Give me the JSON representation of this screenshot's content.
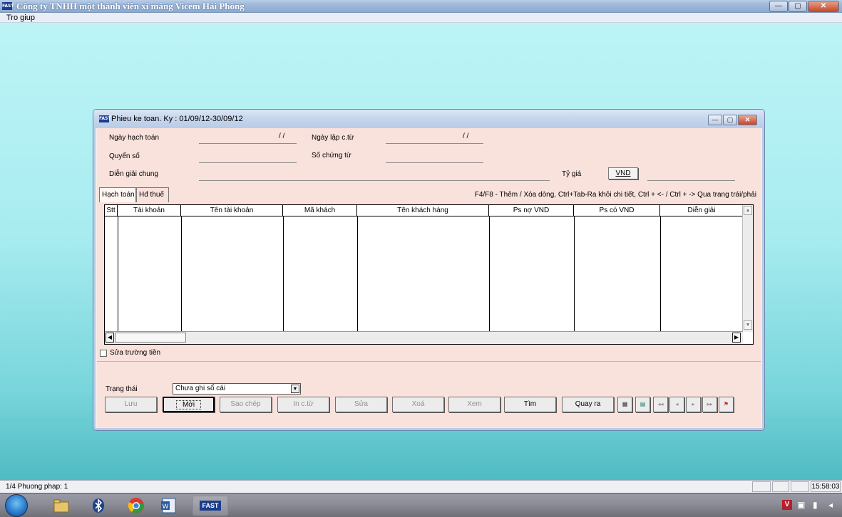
{
  "app": {
    "title": "Công ty TNHH một thành viên xi măng Vicem Hải Phòng",
    "logo_text": "FAST",
    "window_buttons": [
      "—",
      "▢",
      "✕"
    ]
  },
  "menu": {
    "items": [
      "Tro giup"
    ]
  },
  "form": {
    "title": "Phieu ke toan. Ky : 01/09/12-30/09/12",
    "window_buttons": [
      "—",
      "▢",
      "✕"
    ],
    "ngay_hach_toan_label": "Ngày hạch toán",
    "ngay_hach_toan_value": "/ /",
    "ngay_lap_label": "Ngày lập c.từ",
    "ngay_lap_value": "/ /",
    "quyen_so_label": "Quyển số",
    "so_chung_tu_label": "Số chứng từ",
    "dien_giai_label": "Diễn giải chung",
    "ty_gia_label": "Tỷ giá",
    "currency_button": "VND",
    "tabs": [
      "Hạch toán",
      "Hđ thuế"
    ],
    "hint": "F4/F8 - Thêm / Xóa dòng, Ctrl+Tab-Ra khỏi chi tiết, Ctrl + <- / Ctrl + -> Qua trang trái/phải",
    "columns": [
      "Stt",
      "Tài khoản",
      "Tên tài khoản",
      "Mã khách",
      "Tên khách hàng",
      "Ps nợ VND",
      "Ps có VND",
      "Diễn giải"
    ],
    "checkbox_label": "Sửa trường tiền",
    "trang_thai_label": "Trạng thái",
    "trang_thai_value": "Chưa ghi sổ cái",
    "buttons": {
      "luu": "Lưu",
      "moi": "Mới",
      "sao_chep": "Sao chép",
      "in_ctu": "In c.từ",
      "sua": "Sửa",
      "xoa": "Xoá",
      "xem": "Xem",
      "tim": "Tìm",
      "quay_ra": "Quay ra"
    },
    "nav_glyphs": [
      "◂◂",
      "◂",
      "▸",
      "▸▸"
    ]
  },
  "status": {
    "text": "1/4 Phuong phap: 1",
    "time": "15:58:03"
  },
  "taskbar": {
    "fast_label": "FAST",
    "tray_letter": "V"
  }
}
